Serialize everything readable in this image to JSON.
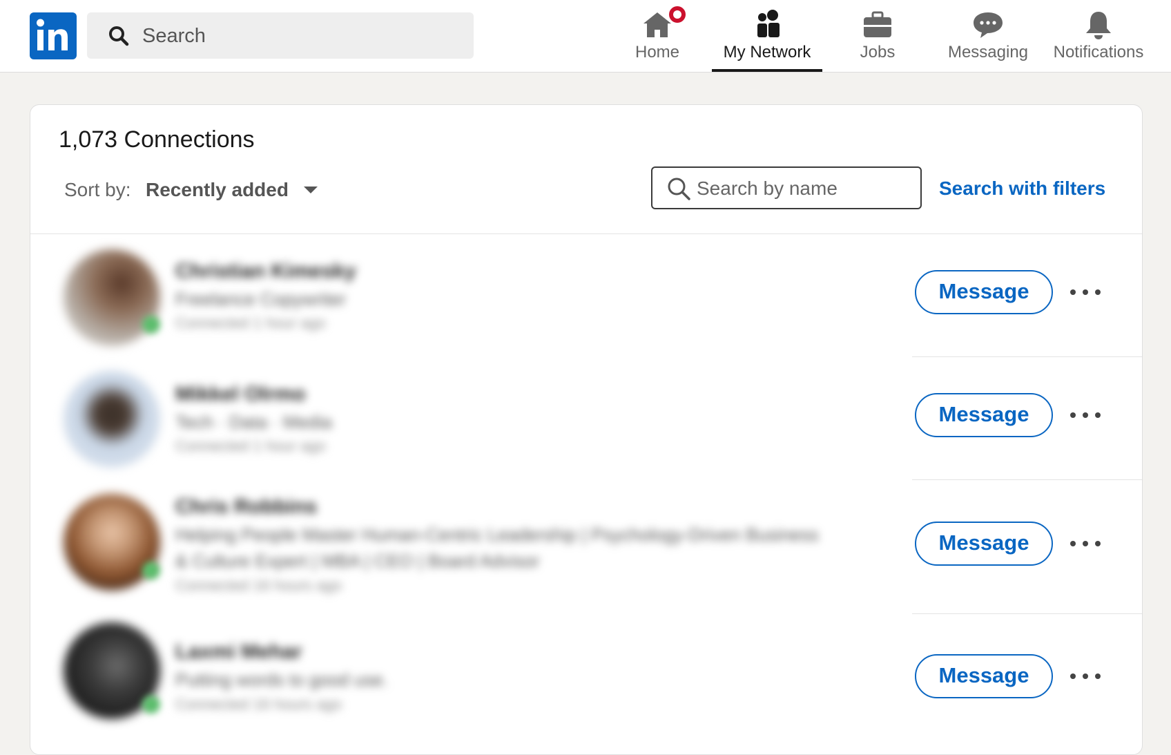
{
  "nav": {
    "search_placeholder": "Search",
    "items": [
      {
        "label": "Home",
        "icon": "home-icon",
        "notification": true
      },
      {
        "label": "My Network",
        "icon": "people-icon",
        "active": true
      },
      {
        "label": "Jobs",
        "icon": "briefcase-icon"
      },
      {
        "label": "Messaging",
        "icon": "chat-icon"
      },
      {
        "label": "Notifications",
        "icon": "bell-icon"
      }
    ]
  },
  "connections": {
    "title": "1,073 Connections",
    "sort_label": "Sort by:",
    "sort_value": "Recently added",
    "search_placeholder": "Search by name",
    "filters_link": "Search with filters",
    "rows": [
      {
        "message_label": "Message"
      },
      {
        "message_label": "Message"
      },
      {
        "message_label": "Message"
      },
      {
        "message_label": "Message"
      }
    ]
  },
  "colors": {
    "brand": "#0a66c2",
    "notification_badge": "#cb112d",
    "page_background": "#f3f2ef",
    "online": "#5bbd6c"
  }
}
